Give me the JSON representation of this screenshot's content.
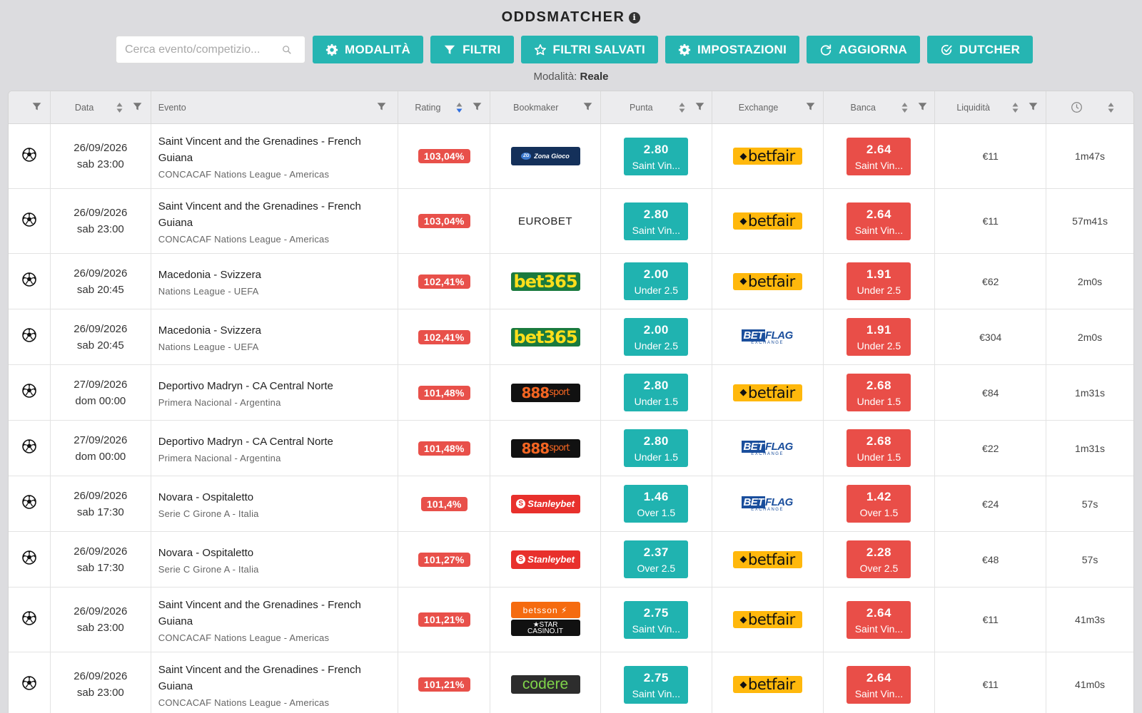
{
  "app": {
    "title": "ODDSMATCHER",
    "info_icon": "info-icon"
  },
  "toolbar": {
    "search_placeholder": "Cerca evento/competizio...",
    "modalita": "MODALITÀ",
    "filtri": "FILTRI",
    "filtri_salvati": "FILTRI SALVATI",
    "impostazioni": "IMPOSTAZIONI",
    "aggiorna": "AGGIORNA",
    "dutcher": "DUTCHER"
  },
  "mode": {
    "label": "Modalità:",
    "value": "Reale"
  },
  "colors": {
    "accent": "#26b5b2",
    "lay": "#e94e48",
    "rating": "#e8504a",
    "background": "#dcdcdf"
  },
  "table": {
    "headers": {
      "data": "Data",
      "evento": "Evento",
      "rating": "Rating",
      "bookmaker": "Bookmaker",
      "punta": "Punta",
      "exchange": "Exchange",
      "banca": "Banca",
      "liquidita": "Liquidità",
      "time_icon": "clock-icon"
    },
    "rows": [
      {
        "sport_icon": "soccer-ball-icon",
        "date": "26/09/2026",
        "time": "sab 23:00",
        "event": "Saint Vincent and the Grenadines - French Guiana",
        "competition": "CONCACAF Nations League - Americas",
        "rating": "103,04%",
        "bookmaker": "Zona Gioco",
        "back_odd": "2.80",
        "back_market": "Saint Vin...",
        "exchange": "betfair",
        "lay_odd": "2.64",
        "lay_market": "Saint Vin...",
        "liquidity": "€11",
        "age": "1m47s"
      },
      {
        "sport_icon": "soccer-ball-icon",
        "date": "26/09/2026",
        "time": "sab 23:00",
        "event": "Saint Vincent and the Grenadines - French Guiana",
        "competition": "CONCACAF Nations League - Americas",
        "rating": "103,04%",
        "bookmaker": "EUROBET",
        "back_odd": "2.80",
        "back_market": "Saint Vin...",
        "exchange": "betfair",
        "lay_odd": "2.64",
        "lay_market": "Saint Vin...",
        "liquidity": "€11",
        "age": "57m41s"
      },
      {
        "sport_icon": "soccer-ball-icon",
        "date": "26/09/2026",
        "time": "sab 20:45",
        "event": "Macedonia - Svizzera",
        "competition": "Nations League - UEFA",
        "rating": "102,41%",
        "bookmaker": "bet365",
        "back_odd": "2.00",
        "back_market": "Under 2.5",
        "exchange": "betfair",
        "lay_odd": "1.91",
        "lay_market": "Under 2.5",
        "liquidity": "€62",
        "age": "2m0s"
      },
      {
        "sport_icon": "soccer-ball-icon",
        "date": "26/09/2026",
        "time": "sab 20:45",
        "event": "Macedonia - Svizzera",
        "competition": "Nations League - UEFA",
        "rating": "102,41%",
        "bookmaker": "bet365",
        "back_odd": "2.00",
        "back_market": "Under 2.5",
        "exchange": "BETFLAG",
        "lay_odd": "1.91",
        "lay_market": "Under 2.5",
        "liquidity": "€304",
        "age": "2m0s"
      },
      {
        "sport_icon": "soccer-ball-icon",
        "date": "27/09/2026",
        "time": "dom 00:00",
        "event": "Deportivo Madryn - CA Central Norte",
        "competition": "Primera Nacional - Argentina",
        "rating": "101,48%",
        "bookmaker": "888sport",
        "back_odd": "2.80",
        "back_market": "Under 1.5",
        "exchange": "betfair",
        "lay_odd": "2.68",
        "lay_market": "Under 1.5",
        "liquidity": "€84",
        "age": "1m31s"
      },
      {
        "sport_icon": "soccer-ball-icon",
        "date": "27/09/2026",
        "time": "dom 00:00",
        "event": "Deportivo Madryn - CA Central Norte",
        "competition": "Primera Nacional - Argentina",
        "rating": "101,48%",
        "bookmaker": "888sport",
        "back_odd": "2.80",
        "back_market": "Under 1.5",
        "exchange": "BETFLAG",
        "lay_odd": "2.68",
        "lay_market": "Under 1.5",
        "liquidity": "€22",
        "age": "1m31s"
      },
      {
        "sport_icon": "soccer-ball-icon",
        "date": "26/09/2026",
        "time": "sab 17:30",
        "event": "Novara - Ospitaletto",
        "competition": "Serie C Girone A - Italia",
        "rating": "101,4%",
        "bookmaker": "Stanleybet",
        "back_odd": "1.46",
        "back_market": "Over 1.5",
        "exchange": "BETFLAG",
        "lay_odd": "1.42",
        "lay_market": "Over 1.5",
        "liquidity": "€24",
        "age": "57s"
      },
      {
        "sport_icon": "soccer-ball-icon",
        "date": "26/09/2026",
        "time": "sab 17:30",
        "event": "Novara - Ospitaletto",
        "competition": "Serie C Girone A - Italia",
        "rating": "101,27%",
        "bookmaker": "Stanleybet",
        "back_odd": "2.37",
        "back_market": "Over 2.5",
        "exchange": "betfair",
        "lay_odd": "2.28",
        "lay_market": "Over 2.5",
        "liquidity": "€48",
        "age": "57s"
      },
      {
        "sport_icon": "soccer-ball-icon",
        "date": "26/09/2026",
        "time": "sab 23:00",
        "event": "Saint Vincent and the Grenadines - French Guiana",
        "competition": "CONCACAF Nations League - Americas",
        "rating": "101,21%",
        "bookmaker": "betsson STAR CASINO.IT",
        "back_odd": "2.75",
        "back_market": "Saint Vin...",
        "exchange": "betfair",
        "lay_odd": "2.64",
        "lay_market": "Saint Vin...",
        "liquidity": "€11",
        "age": "41m3s"
      },
      {
        "sport_icon": "soccer-ball-icon",
        "date": "26/09/2026",
        "time": "sab 23:00",
        "event": "Saint Vincent and the Grenadines - French Guiana",
        "competition": "CONCACAF Nations League - Americas",
        "rating": "101,21%",
        "bookmaker": "codere",
        "back_odd": "2.75",
        "back_market": "Saint Vin...",
        "exchange": "betfair",
        "lay_odd": "2.64",
        "lay_market": "Saint Vin...",
        "liquidity": "€11",
        "age": "41m0s"
      }
    ]
  }
}
